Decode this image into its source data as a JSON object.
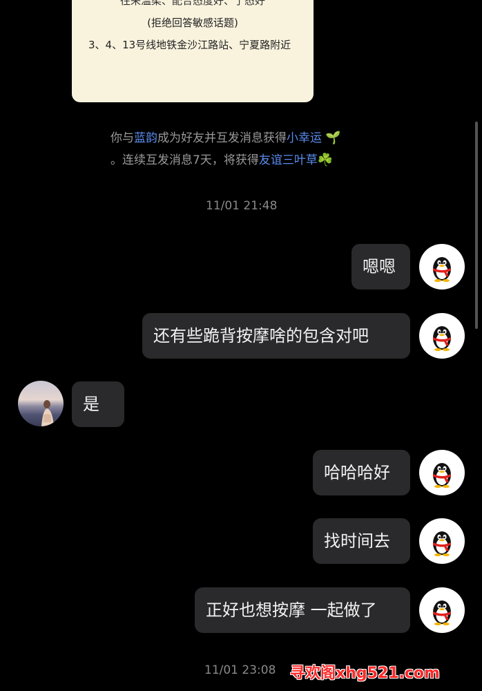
{
  "card": {
    "line_top": "往来温柔、配合态度好、了态好",
    "line_mid": "(拒绝回答敏感话题)",
    "line_addr": "3、4、13号线地铁金沙江路站、宁夏路附近"
  },
  "system_message": {
    "part1": "你与",
    "name": "蓝韵",
    "part2": "成为好友并互发消息获得",
    "reward1": "小幸运",
    "emoji1": "🌱",
    "part3": "。连续互发消息7天，将获得",
    "reward2": "友谊三叶草",
    "emoji2": "☘️"
  },
  "timestamps": [
    "11/01 21:48",
    "11/01 23:08"
  ],
  "messages": [
    {
      "side": "right",
      "text": "嗯嗯"
    },
    {
      "side": "right",
      "text": "还有些跪背按摩啥的包含对吧"
    },
    {
      "side": "left",
      "text": "是"
    },
    {
      "side": "right",
      "text": "哈哈哈好"
    },
    {
      "side": "right",
      "text": "找时间去"
    },
    {
      "side": "right",
      "text": "正好也想按摩 一起做了"
    }
  ],
  "watermark": "寻欢阁xhg521.com",
  "colors": {
    "background": "#000000",
    "bubble": "#2a2a2c",
    "card": "#f9f3de",
    "highlight": "#5b8def",
    "watermark": "#ff2a2a"
  },
  "icons": {
    "self_avatar": "qq-penguin-icon",
    "friend_avatar": "profile-photo"
  }
}
